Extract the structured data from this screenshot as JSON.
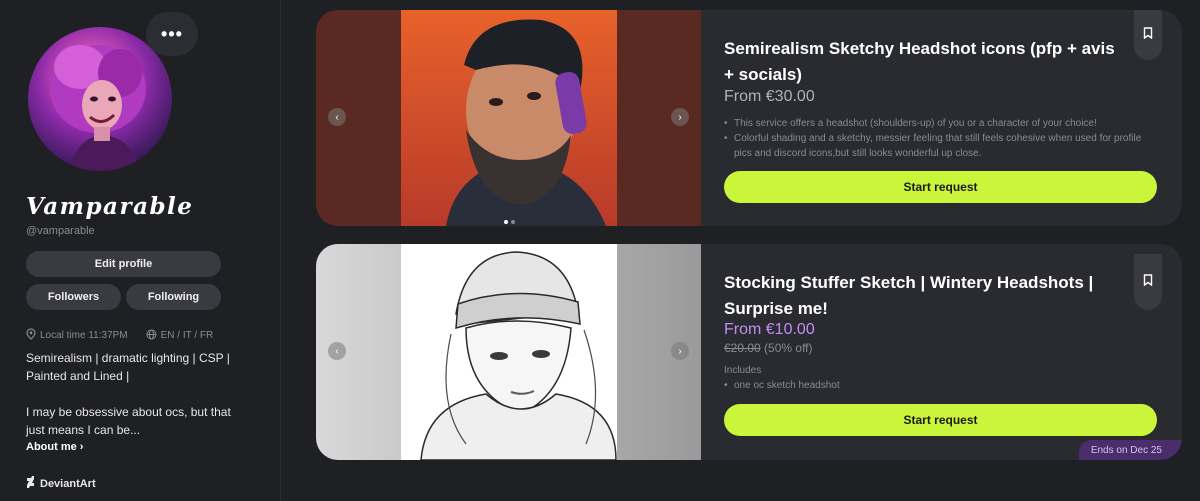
{
  "profile": {
    "display_name": "Vamparable",
    "handle": "@vamparable",
    "more_label": "•••",
    "edit_label": "Edit profile",
    "followers_label": "Followers",
    "following_label": "Following",
    "local_time": "Local time 11:37PM",
    "languages": "EN / IT / FR",
    "bio_line1": "Semirealism | dramatic lighting | CSP | Painted and Lined |",
    "bio_line2": "I may be obsessive about ocs, but that just means I can be...",
    "about_label": "About me ›",
    "platform_label": "DeviantArt"
  },
  "cards": [
    {
      "title": "Semirealism Sketchy Headshot icons (pfp + avis + socials)",
      "price": "From €30.00",
      "bullets": [
        "This service offers a headshot (shoulders-up) of you or a character of your choice!",
        "Colorful shading and a sketchy, messier feeling that still feels cohesive when used for profile pics and discord icons,but still looks wonderful up close."
      ],
      "cta": "Start request"
    },
    {
      "title": "Stocking Stuffer Sketch | Wintery Headshots | Surprise me!",
      "price": "From €10.00",
      "old_price": "€20.00",
      "discount": "(50% off)",
      "includes_label": "Includes",
      "includes": [
        "one oc sketch headshot"
      ],
      "cta": "Start request",
      "ends": "Ends on Dec 25"
    }
  ],
  "colors": {
    "accent": "#c9f53a",
    "background": "#1f2024",
    "card": "#2a2b31",
    "promo_purple": "#c18ef0"
  },
  "icons": {
    "more": "ellipsis-icon",
    "bookmark": "bookmark-icon",
    "location": "location-pin-icon",
    "globe": "globe-icon",
    "deviantart": "deviantart-icon",
    "prev": "chevron-left-icon",
    "next": "chevron-right-icon"
  }
}
